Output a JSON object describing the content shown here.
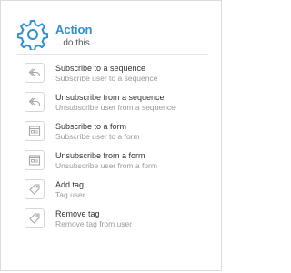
{
  "header": {
    "title": "Action",
    "subtitle": "...do this.",
    "icon": "gear-icon"
  },
  "actions": [
    {
      "title": "Subscribe to a sequence",
      "subtitle": "Subscribe user to a sequence",
      "icon": "reply-arrow-icon"
    },
    {
      "title": "Unsubscribe from a sequence",
      "subtitle": "Unsubscribe user from a sequence",
      "icon": "reply-arrow-icon"
    },
    {
      "title": "Subscribe to a form",
      "subtitle": "Subscribe user to a form",
      "icon": "form-icon"
    },
    {
      "title": "Unsubscribe from a form",
      "subtitle": "Unsubscribe user from a form",
      "icon": "form-icon"
    },
    {
      "title": "Add tag",
      "subtitle": "Tag user",
      "icon": "tag-icon"
    },
    {
      "title": "Remove tag",
      "subtitle": "Remove tag from user",
      "icon": "tag-icon"
    }
  ],
  "colors": {
    "accent": "#2f8fcf",
    "icon_stroke": "#a8a8a8",
    "item_text": "#333333",
    "item_subtext": "#9a9a9a"
  }
}
